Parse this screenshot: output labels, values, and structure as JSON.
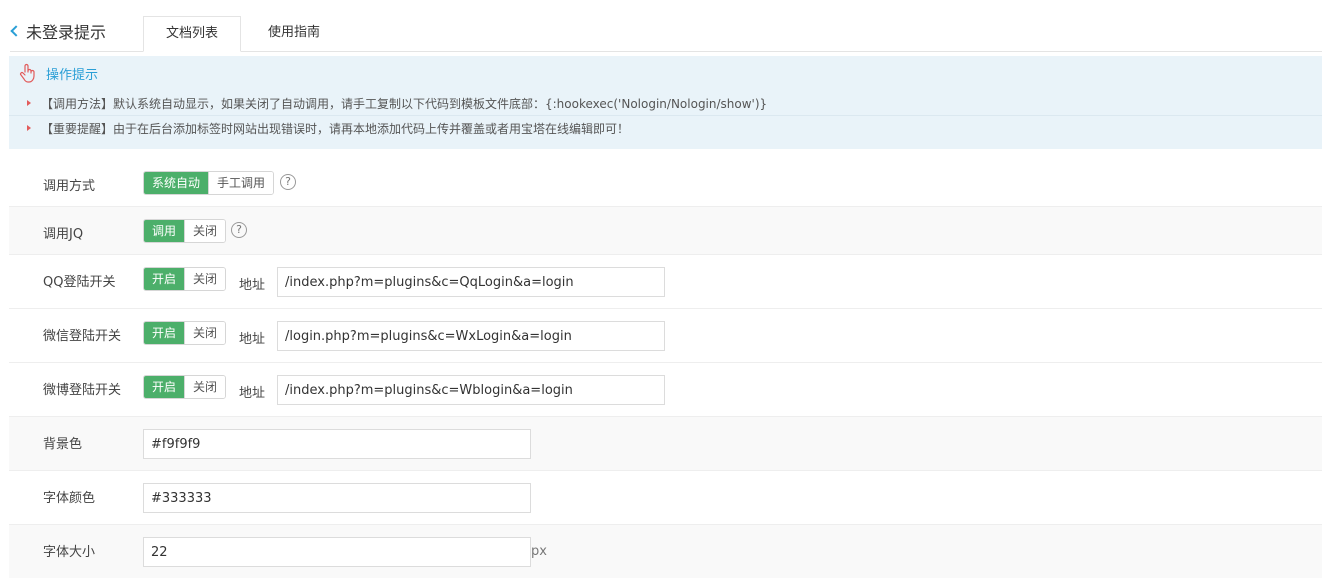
{
  "header": {
    "back_title": "未登录提示",
    "tabs": [
      {
        "label": "文档列表",
        "active": true
      },
      {
        "label": "使用指南",
        "active": false
      }
    ]
  },
  "tips": {
    "title": "操作提示",
    "items": [
      "【调用方法】默认系统自动显示，如果关闭了自动调用，请手工复制以下代码到模板文件底部：{:hookexec('Nologin/Nologin/show')}",
      "【重要提醒】由于在后台添加标签时网站出现错误时，请再本地添加代码上传并覆盖或者用宝塔在线编辑即可！"
    ]
  },
  "form": {
    "call_mode": {
      "label": "调用方式",
      "options": [
        "系统自动",
        "手工调用"
      ],
      "selected": "系统自动"
    },
    "call_jq": {
      "label": "调用JQ",
      "options": [
        "调用",
        "关闭"
      ],
      "selected": "调用"
    },
    "qq_login": {
      "label": "QQ登陆开关",
      "options": [
        "开启",
        "关闭"
      ],
      "selected": "开启",
      "addr_label": "地址",
      "addr_value": "/index.php?m=plugins&c=QqLogin&a=login"
    },
    "wx_login": {
      "label": "微信登陆开关",
      "options": [
        "开启",
        "关闭"
      ],
      "selected": "开启",
      "addr_label": "地址",
      "addr_value": "/login.php?m=plugins&c=WxLogin&a=login"
    },
    "wb_login": {
      "label": "微博登陆开关",
      "options": [
        "开启",
        "关闭"
      ],
      "selected": "开启",
      "addr_label": "地址",
      "addr_value": "/index.php?m=plugins&c=Wblogin&a=login"
    },
    "bg_color": {
      "label": "背景色",
      "value": "#f9f9f9"
    },
    "font_color": {
      "label": "字体颜色",
      "value": "#333333"
    },
    "font_size": {
      "label": "字体大小",
      "value": "22",
      "unit": "px"
    },
    "help_symbol": "?"
  },
  "colors": {
    "accent": "#2a9fd6",
    "toggle_on": "#4caf6a",
    "tips_bg": "#e9f3f9"
  }
}
